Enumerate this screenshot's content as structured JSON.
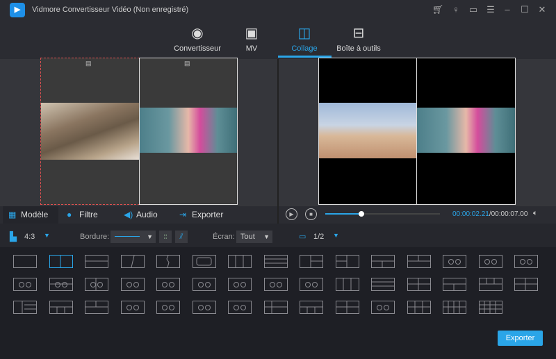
{
  "app": {
    "title": "Vidmore Convertisseur Vidéo (Non enregistré)",
    "logo_icon": "video-camera-icon"
  },
  "window_controls": [
    "cart-icon",
    "key-icon",
    "chat-icon",
    "menu-icon",
    "minimize-icon",
    "maximize-icon",
    "close-icon"
  ],
  "nav": {
    "tabs": [
      {
        "label": "Convertisseur",
        "icon": "convert-icon"
      },
      {
        "label": "MV",
        "icon": "tv-icon"
      },
      {
        "label": "Collage",
        "icon": "collage-icon",
        "active": true
      },
      {
        "label": "Boîte à outils",
        "icon": "toolbox-icon"
      }
    ]
  },
  "editor_tabs": [
    {
      "label": "Modèle",
      "icon": "template-icon",
      "active": true
    },
    {
      "label": "Filtre",
      "icon": "filter-icon"
    },
    {
      "label": "Audio",
      "icon": "audio-icon"
    },
    {
      "label": "Exporter",
      "icon": "export-icon"
    }
  ],
  "player": {
    "current_time": "00:00:02.21",
    "total_time": "/00:00:07.00",
    "progress_percent": 31.6
  },
  "controls": {
    "ratio": "4:3",
    "border_label": "Bordure:",
    "screen_label": "Écran:",
    "screen_value": "Tout",
    "page": "1/2"
  },
  "templates": {
    "count": 44,
    "selected_index": 1
  },
  "export_button": "Exporter",
  "colors": {
    "accent": "#2aa5e8",
    "selection": "#e05050"
  }
}
